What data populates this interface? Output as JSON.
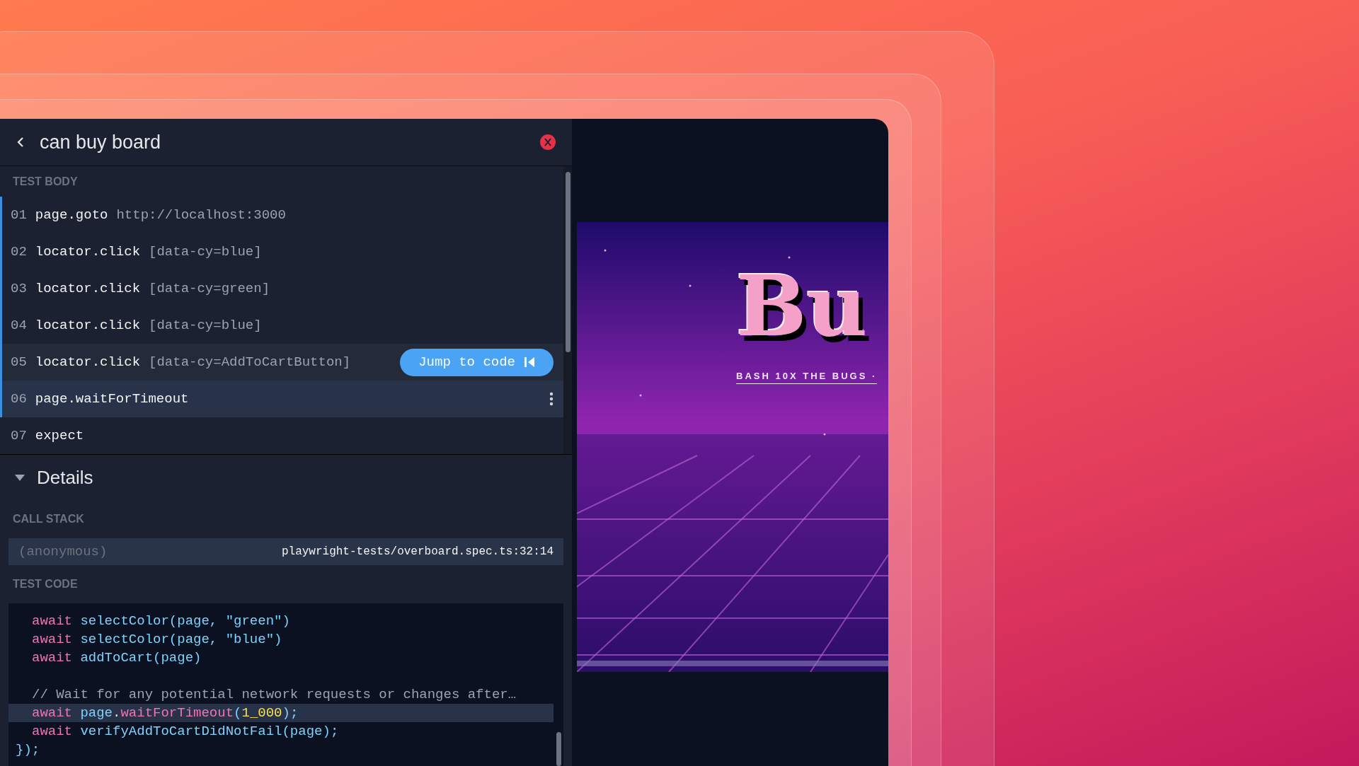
{
  "panel": {
    "title": "can buy board",
    "test_body_label": "TEST BODY",
    "steps": [
      {
        "number": "01",
        "command": "page.goto",
        "argument": "http://localhost:3000",
        "in_run": true,
        "hovered": false,
        "selected": false
      },
      {
        "number": "02",
        "command": "locator.click",
        "argument": "[data-cy=blue]",
        "in_run": true,
        "hovered": false,
        "selected": false
      },
      {
        "number": "03",
        "command": "locator.click",
        "argument": "[data-cy=green]",
        "in_run": true,
        "hovered": false,
        "selected": false
      },
      {
        "number": "04",
        "command": "locator.click",
        "argument": "[data-cy=blue]",
        "in_run": true,
        "hovered": false,
        "selected": false
      },
      {
        "number": "05",
        "command": "locator.click",
        "argument": "[data-cy=AddToCartButton]",
        "in_run": true,
        "hovered": true,
        "selected": false
      },
      {
        "number": "06",
        "command": "page.waitForTimeout",
        "in_run": true,
        "hovered": false,
        "selected": true
      },
      {
        "number": "07",
        "command": "expect",
        "in_run": false,
        "hovered": false,
        "selected": false
      }
    ],
    "jump_button": "Jump to code",
    "details": {
      "title": "Details",
      "expanded": true,
      "call_stack_label": "CALL STACK",
      "call_stack": [
        {
          "function": "(anonymous)",
          "location": "playwright-tests/overboard.spec.ts:32:14"
        }
      ],
      "test_code_label": "TEST CODE",
      "code_lines": [
        {
          "selected": false,
          "indented": true,
          "blank_before": false,
          "segments": [
            {
              "kind": "keyword",
              "text": "await"
            },
            {
              "kind": "call",
              "text": " selectColor(page, "
            },
            {
              "kind": "string",
              "text": "\"green\""
            },
            {
              "kind": "call",
              "text": ")"
            }
          ]
        },
        {
          "selected": false,
          "indented": true,
          "blank_before": false,
          "segments": [
            {
              "kind": "keyword",
              "text": "await"
            },
            {
              "kind": "call",
              "text": " selectColor(page, "
            },
            {
              "kind": "string",
              "text": "\"blue\""
            },
            {
              "kind": "call",
              "text": ")"
            }
          ]
        },
        {
          "selected": false,
          "indented": true,
          "blank_before": false,
          "segments": [
            {
              "kind": "keyword",
              "text": "await"
            },
            {
              "kind": "call",
              "text": " addToCart(page)"
            }
          ]
        },
        {
          "selected": false,
          "indented": true,
          "blank_before": true,
          "segments": [
            {
              "kind": "comment",
              "text": "// Wait for any potential network requests or changes after…"
            }
          ]
        },
        {
          "selected": true,
          "indented": true,
          "blank_before": false,
          "segments": [
            {
              "kind": "keyword",
              "text": "await"
            },
            {
              "kind": "call",
              "text": " page"
            },
            {
              "kind": "plain",
              "text": "."
            },
            {
              "kind": "method",
              "text": "waitForTimeout"
            },
            {
              "kind": "call",
              "text": "("
            },
            {
              "kind": "number",
              "text": "1_000"
            },
            {
              "kind": "call",
              "text": ");"
            }
          ]
        },
        {
          "selected": false,
          "indented": true,
          "blank_before": false,
          "segments": [
            {
              "kind": "keyword",
              "text": "await"
            },
            {
              "kind": "call",
              "text": " verifyAddToCartDidNotFail(page);"
            }
          ]
        },
        {
          "selected": false,
          "indented": false,
          "blank_before": false,
          "segments": [
            {
              "kind": "call",
              "text": "});"
            }
          ]
        }
      ]
    }
  },
  "preview": {
    "logo": "Bu",
    "tagline": "BASH 10X THE BUGS ·"
  }
}
